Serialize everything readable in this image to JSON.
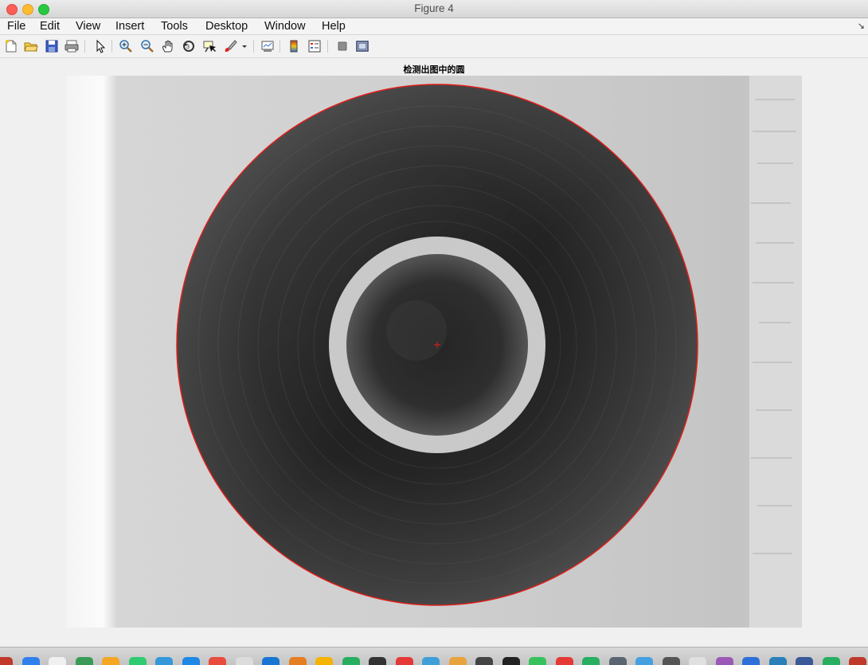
{
  "window": {
    "title": "Figure 4"
  },
  "menu": [
    "File",
    "Edit",
    "View",
    "Insert",
    "Tools",
    "Desktop",
    "Window",
    "Help"
  ],
  "toolbar": {
    "buttons": [
      "new-figure",
      "open-file",
      "save",
      "print",
      "edit-plot",
      "zoom-in",
      "zoom-out",
      "pan",
      "rotate-3d",
      "data-cursor",
      "brush",
      "insert-colorbar",
      "insert-legend",
      "hide-plot-tools",
      "show-plot-tools"
    ]
  },
  "axes": {
    "title": "检测出图中的圆"
  },
  "image": {
    "description_icon": "grayscale-tape-roll-image",
    "detected_circle_color": "#e0201a",
    "center_marker": "+",
    "center_marker_color": "#e0201a"
  },
  "dock": {
    "icons": [
      "#c0392b",
      "#2f80ed",
      "#f0f0f0",
      "#3a9b57",
      "#f5a623",
      "#2ecc71",
      "#3498db",
      "#1e88e5",
      "#e74c3c",
      "#dcdcdc",
      "#1976d2",
      "#e67e22",
      "#f5b400",
      "#27ae60",
      "#333333",
      "#e53935",
      "#3f9fd8",
      "#e8a33d",
      "#444444",
      "#222222",
      "#37c15c",
      "#e53935",
      "#27ae60",
      "#5a6570",
      "#45a0e0",
      "#555555",
      "#e0e0e0",
      "#9b59b6",
      "#2f6fd8",
      "#2980b9",
      "#3b5998",
      "#27ae60",
      "#c0392b"
    ]
  }
}
